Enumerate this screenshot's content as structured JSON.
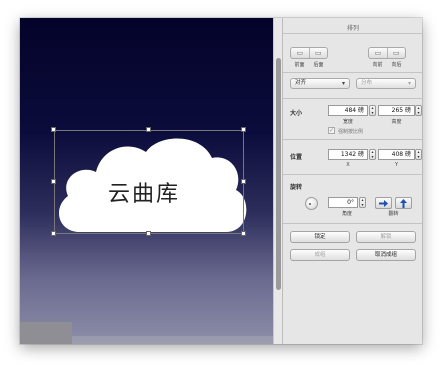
{
  "canvas": {
    "cloud_text": "云曲库"
  },
  "inspector": {
    "title": "排列",
    "arrange_buttons": [
      {
        "label": "前面",
        "icon": "bring-forward-icon"
      },
      {
        "label": "后面",
        "icon": "send-backward-icon"
      },
      {
        "label": "左对齐",
        "icon": "align-left-icon"
      },
      {
        "label": "右对齐",
        "icon": "align-right-icon"
      }
    ],
    "arrange_labels": [
      "前面",
      "后面",
      "向前",
      "向后"
    ],
    "align_popup": "对齐",
    "distribute_popup": "分布",
    "size": {
      "label": "大小",
      "width_value": "484 磅",
      "height_value": "265 磅",
      "width_label": "宽度",
      "height_label": "高度",
      "constrain_label": "强制按比例",
      "constrain_checked": true
    },
    "position": {
      "label": "位置",
      "x_value": "1342 磅",
      "y_value": "408 磅",
      "x_label": "X",
      "y_label": "Y"
    },
    "rotate": {
      "label": "旋转",
      "angle_value": "0°",
      "angle_label": "角度",
      "flip_label": "翻转"
    },
    "buttons": {
      "lock": "锁定",
      "unlock": "解锁",
      "group": "成组",
      "ungroup": "取消成组"
    }
  }
}
